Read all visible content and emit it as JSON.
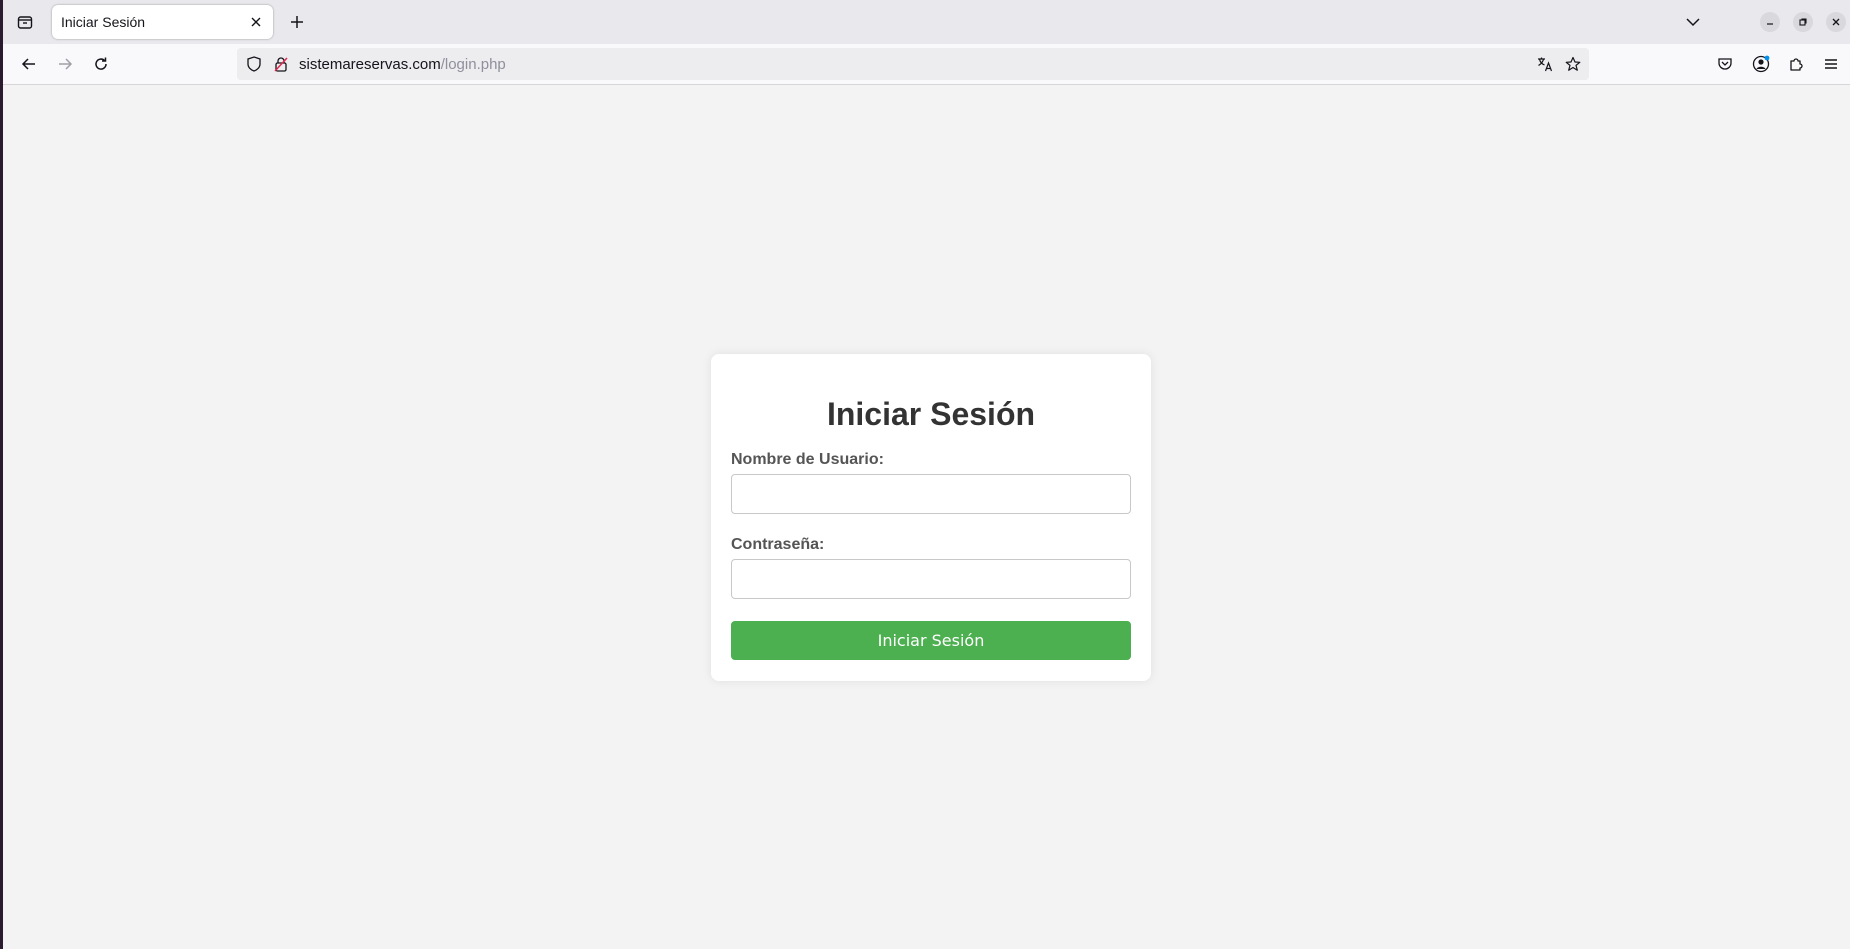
{
  "browser": {
    "tab": {
      "title": "Iniciar Sesión"
    },
    "url": {
      "domain": "sistemareservas.com",
      "path": "/login.php"
    }
  },
  "login": {
    "heading": "Iniciar Sesión",
    "username_label": "Nombre de Usuario:",
    "username_value": "",
    "password_label": "Contraseña:",
    "password_value": "",
    "submit_label": "Iniciar Sesión"
  },
  "colors": {
    "page_background": "#f3f3f3",
    "card_background": "#ffffff",
    "submit_button": "#4caf50",
    "heading_text": "#333333"
  }
}
